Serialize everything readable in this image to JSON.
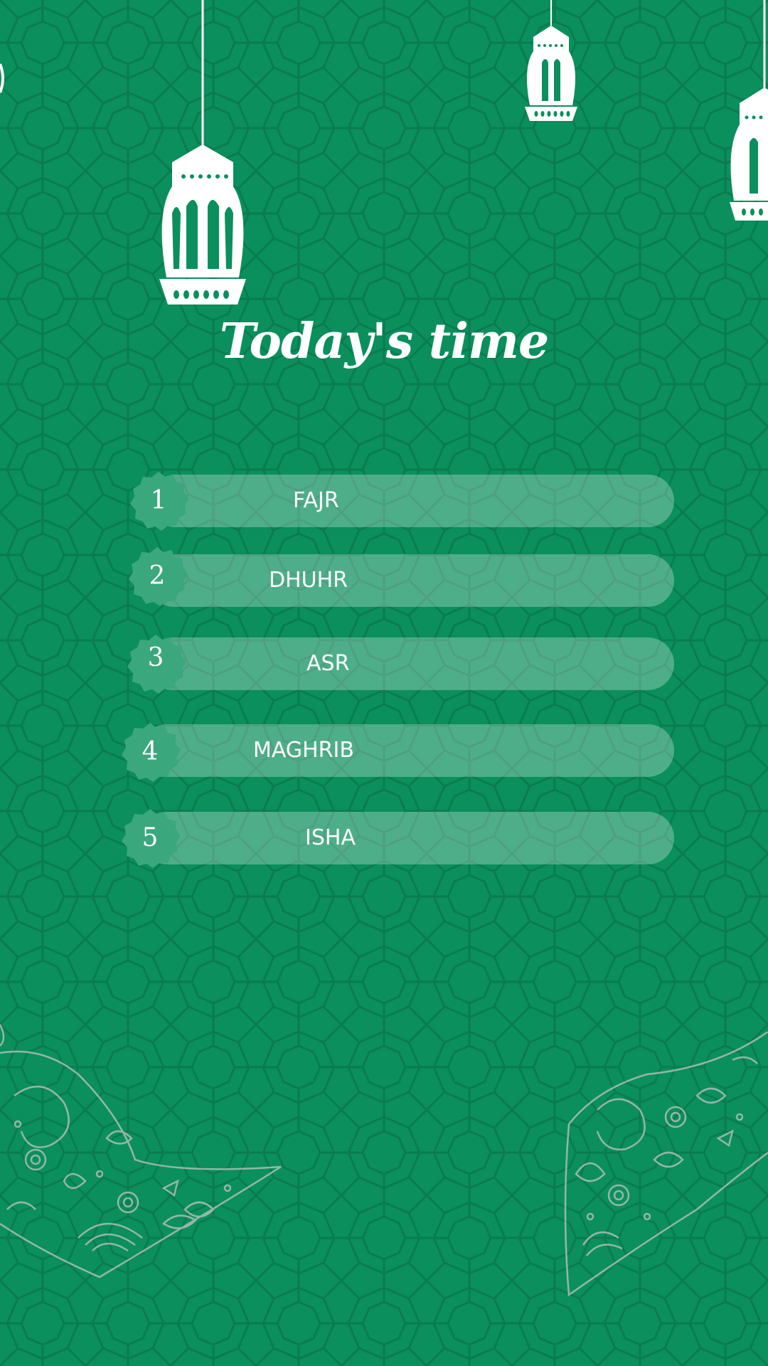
{
  "colors": {
    "background": "#0b8f5c",
    "pattern_stroke": "#087a4e",
    "bar_fill": "rgba(255,255,255,0.28)",
    "badge_fill": "#3aa77c",
    "text": "#ffffff",
    "lantern": "#ffffff",
    "deco_stroke": "#c9c9c9"
  },
  "header": {
    "title": "Today's time"
  },
  "prayers": [
    {
      "number": "1",
      "name": "FAJR"
    },
    {
      "number": "2",
      "name": "DHUHR"
    },
    {
      "number": "3",
      "name": "ASR"
    },
    {
      "number": "4",
      "name": "MAGHRIB"
    },
    {
      "number": "5",
      "name": "ISHA"
    }
  ],
  "icons": {
    "lantern": "lantern-icon",
    "badge": "scalloped-badge-icon",
    "decoration": "paisley-ornament-icon"
  }
}
